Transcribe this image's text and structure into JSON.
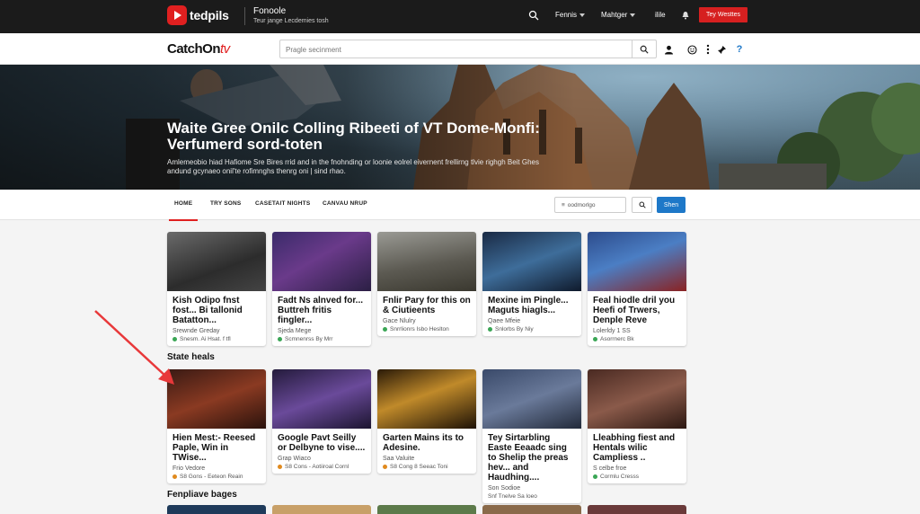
{
  "topbar": {
    "logo": "tedpils",
    "title": "Fonoole",
    "subtitle": "Teur jange Lecdemies tosh",
    "menu": [
      {
        "label": "Fennis",
        "has_caret": true
      },
      {
        "label": "Mahtger",
        "has_caret": true
      },
      {
        "label": "ilile",
        "has_caret": false
      }
    ],
    "cta": "Tey Westtes"
  },
  "header": {
    "brand": "CatchOn",
    "brand_suffix": "tv",
    "search_placeholder": "Pragle secinment",
    "icons": [
      "search-icon",
      "user-icon",
      "smiley-icon",
      "more-icon",
      "pin-icon",
      "help-icon"
    ]
  },
  "hero": {
    "title": "Waite Gree Onilc Colling Ribeeti of VT Dome-Monfi: Verfumerd sord-toten",
    "description": "Amlemeobio hiad Hafiome Sre Bires rrid and in the fnohnding or loonie eolrel eivernent frellirng tlvie righgh Beit Ghes andund gcynaeo onil'te rofimnghs thenrg oni | sind rhao."
  },
  "nav": {
    "tabs": [
      "HOME",
      "TRY SONS",
      "CASETAIT NIGHTS",
      "CANVAU NRUP"
    ],
    "active_index": 0,
    "filter_placeholder": "oodmorlgo",
    "filter_button": "Shen"
  },
  "sections": [
    {
      "title": "",
      "cards": [
        {
          "title": "Kish Odipo fnst fost... Bi tallonid Batatton...",
          "meta": "Srewnde Greday",
          "stat": "Snesm. Ai Hsat. f tfl",
          "dot": "green"
        },
        {
          "title": "Fadt Ns alnved for... Buttreh fritis fingler...",
          "meta": "Sjeda Mege",
          "stat": "Scmnenrss By Mrr",
          "dot": "green"
        },
        {
          "title": "Fnlir Pary for this on & Ciutieents",
          "meta": "Gace Nlulry",
          "stat": "Snrrlionrs Isbo Heslton",
          "dot": "green"
        },
        {
          "title": "Mexine im Pingle... Maguts hiagls...",
          "meta": "Qaee Mfeie",
          "stat": "Snlorbs By Niy",
          "dot": "green"
        },
        {
          "title": "Feal hiodle dril you Heefi of Trwers, Denple Reve",
          "meta": "Lolerldy 1 SS",
          "stat": "Asorrnerc Bk",
          "dot": "green"
        }
      ]
    },
    {
      "title": "State heals",
      "cards": [
        {
          "title": "Hien Mest:- Reesed Paple, Win in TWise...",
          "meta": "Frio Vedore",
          "stat": "S8 Gons - Eeteon Reain",
          "dot": "orange"
        },
        {
          "title": "Google Pavt Seilly or Delbyne to vise....",
          "meta": "Grap Wiaco",
          "stat": "S8 Cons - Aotiiroal Cornl",
          "dot": "orange"
        },
        {
          "title": "Garten Mains its to Adesine.",
          "meta": "Saa Valuite",
          "stat": "S8 Cong 8 Seeac Toni",
          "dot": "orange"
        },
        {
          "title": "Tey Sirtarbling Easte Eeaadc sing to Shelip the preas hev... and Haudhing....",
          "meta": "Son Sodioe",
          "stat": "Snf Tnelve Sa loeo",
          "dot": "none"
        },
        {
          "title": "Lleabhing fiest and Hentals wilic Campliess ..",
          "meta": "S celbe froe",
          "stat": "Cormlu Cresss",
          "dot": "green"
        }
      ]
    }
  ],
  "bottom_section_title": "Fenpliave bages"
}
